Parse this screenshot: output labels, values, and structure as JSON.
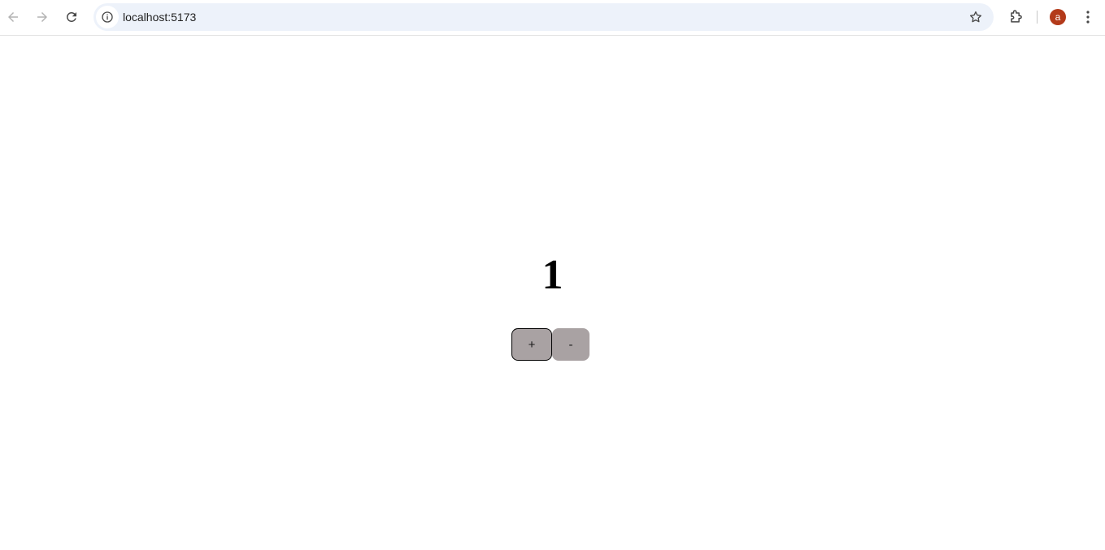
{
  "browser": {
    "url": "localhost:5173",
    "profile_initial": "a",
    "profile_color": "#b33a1a",
    "icons": {
      "back": "arrow-left-icon",
      "forward": "arrow-right-icon",
      "reload": "reload-icon",
      "site_info": "info-icon",
      "bookmark": "star-icon",
      "extensions": "puzzle-icon",
      "menu": "vertical-dots-icon"
    }
  },
  "app": {
    "count": "1",
    "increment_label": "+",
    "decrement_label": "-"
  }
}
